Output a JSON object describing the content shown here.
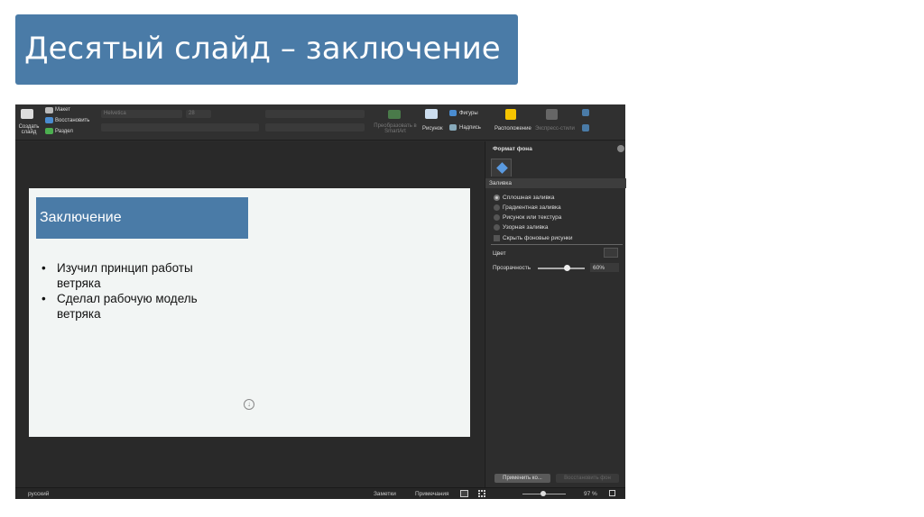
{
  "page_title": "Десятый слайд – заключение",
  "ribbon": {
    "new_slide": "Создать слайд",
    "layout": "Макет",
    "reset": "Восстановить",
    "section": "Раздел",
    "font": "Helvetica",
    "font_size": "28",
    "convert_smartart": "Преобразовать в SmartArt",
    "picture": "Рисунок",
    "shapes": "Фигуры",
    "textbox": "Надпись",
    "arrange": "Расположение",
    "quick_styles": "Экспресс-стили"
  },
  "slide": {
    "title": "Заключение",
    "bullets": [
      "Изучил принцип работы ветряка",
      "Сделал рабочую модель ветряка"
    ]
  },
  "panel": {
    "title": "Формат фона",
    "section": "Заливка",
    "options": [
      "Сплошная заливка",
      "Градиентная заливка",
      "Рисунок или текстура",
      "Узорная заливка"
    ],
    "hide_bg": "Скрыть фоновые рисунки",
    "color_label": "Цвет",
    "transparency_label": "Прозрачность",
    "transparency_value": "60%",
    "transparency": 60,
    "apply_btn": "Применить ко...",
    "reset_btn": "Восстановить фон"
  },
  "status": {
    "language": "русский",
    "notes": "Заметки",
    "comments": "Примечания",
    "zoom": "97 %"
  }
}
